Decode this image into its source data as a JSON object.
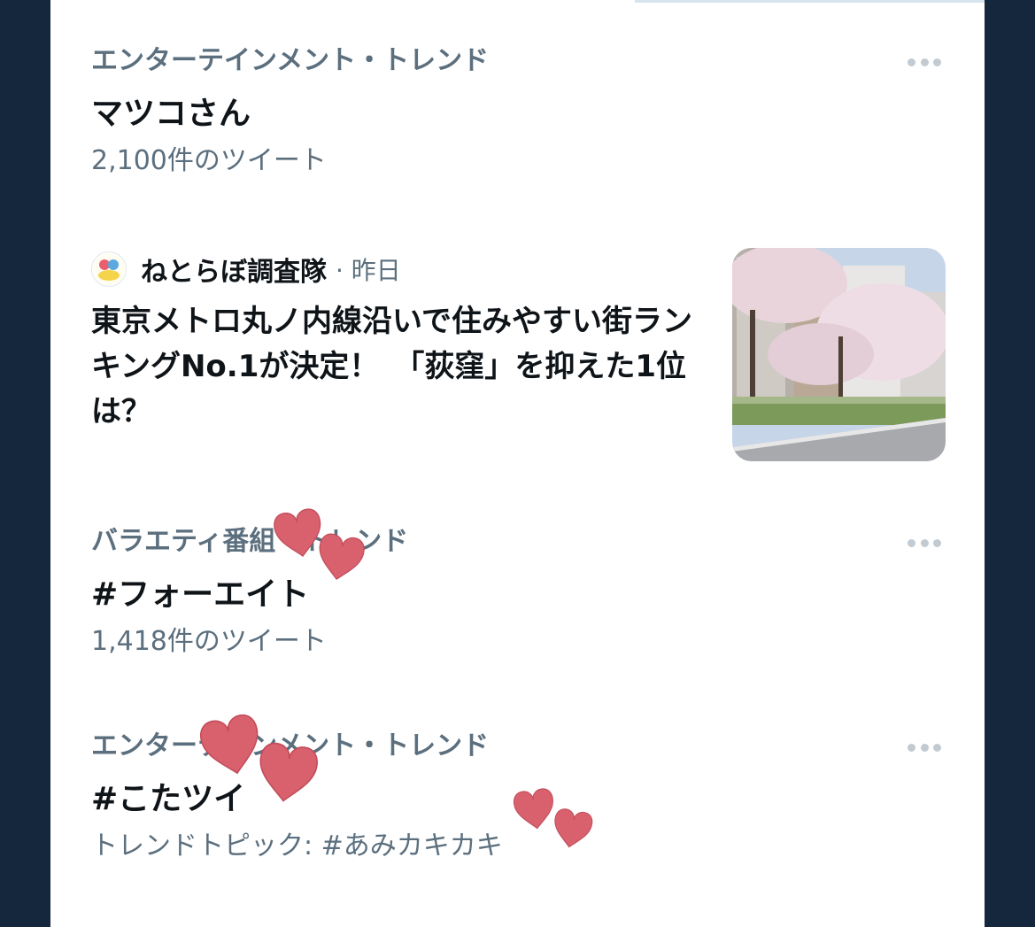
{
  "trends": [
    {
      "category": "エンターテインメント・トレンド",
      "title": "マツコさん",
      "meta": "2,100件のツイート"
    },
    {
      "category": "バラエティ番組・トレンド",
      "title": "#フォーエイト",
      "meta": "1,418件のツイート"
    },
    {
      "category": "エンターテインメント・トレンド",
      "title": "#こたツイ",
      "meta": "トレンドトピック: #あみカキカキ"
    }
  ],
  "news": {
    "source": "ねとらぼ調査隊",
    "time": "· 昨日",
    "headline": "東京メトロ丸ノ内線沿いで住みやすい街ランキングNo.1が決定！　「荻窪」を抑えた1位は？"
  },
  "colors": {
    "frame": "#15273c",
    "text_primary": "#0f1419",
    "text_secondary": "#5b6f7e",
    "heart": "#d9616e"
  },
  "icons": {
    "more": "more-dots-icon",
    "decoration": "heart-icon"
  }
}
